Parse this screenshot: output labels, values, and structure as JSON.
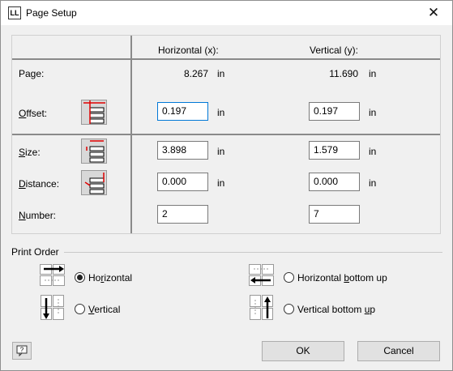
{
  "window": {
    "title": "Page Setup",
    "app_icon": "LL",
    "close_glyph": "✕"
  },
  "columns": {
    "horizontal": "Horizontal (x):",
    "vertical": "Vertical (y):"
  },
  "rows": {
    "page": {
      "label": "Page:",
      "h": "8.267",
      "v": "11.690",
      "unit": "in"
    },
    "offset": {
      "label_pre": "",
      "label_u": "O",
      "label_post": "ffset:",
      "h": "0.197",
      "v": "0.197",
      "unit": "in"
    },
    "size": {
      "label_u": "S",
      "label_post": "ize:",
      "h": "3.898",
      "v": "1.579",
      "unit": "in"
    },
    "distance": {
      "label_u": "D",
      "label_post": "istance:",
      "h": "0.000",
      "v": "0.000",
      "unit": "in"
    },
    "number": {
      "label_u": "N",
      "label_post": "umber:",
      "h": "2",
      "v": "7"
    }
  },
  "print_order": {
    "label": "Print Order",
    "options": {
      "horizontal": {
        "pre": "Ho",
        "u": "r",
        "post": "izontal",
        "checked": true
      },
      "vertical": {
        "pre": "",
        "u": "V",
        "post": "ertical",
        "checked": false
      },
      "horizontal_bottom_up": {
        "pre": "Horizontal ",
        "u": "b",
        "post": "ottom up",
        "checked": false
      },
      "vertical_bottom_up": {
        "pre": "Vertical bottom ",
        "u": "u",
        "post": "p",
        "checked": false
      }
    }
  },
  "buttons": {
    "ok": "OK",
    "cancel": "Cancel",
    "help_icon": "help-icon"
  }
}
